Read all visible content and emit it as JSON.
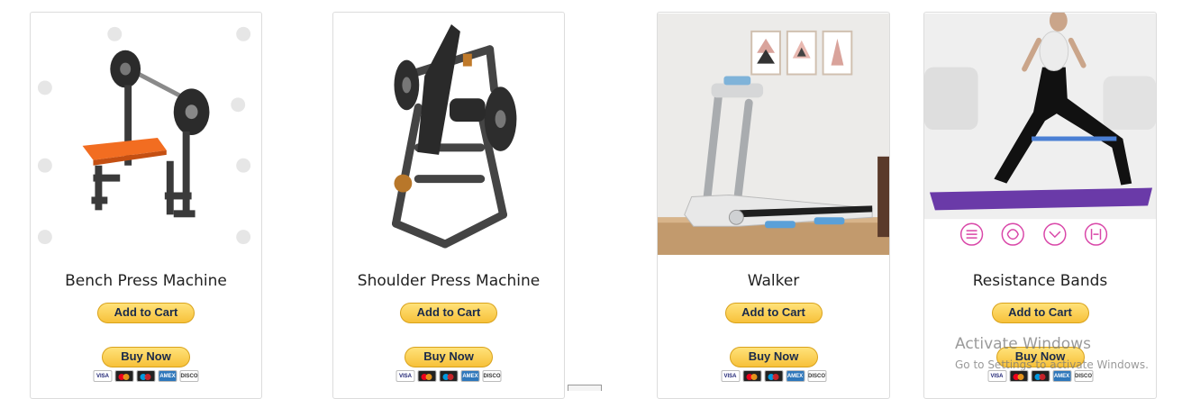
{
  "products": [
    {
      "name": "Bench Press Machine",
      "image_icon": "bench-press-image",
      "add_to_cart": "Add to Cart",
      "buy_now": "Buy Now"
    },
    {
      "name": "Shoulder Press Machine",
      "image_icon": "shoulder-press-image",
      "add_to_cart": "Add to Cart",
      "buy_now": "Buy Now"
    },
    {
      "name": "Walker",
      "image_icon": "treadmill-image",
      "add_to_cart": "Add to Cart",
      "buy_now": "Buy Now"
    },
    {
      "name": "Resistance Bands",
      "image_icon": "resistance-bands-image",
      "add_to_cart": "Add to Cart",
      "buy_now": "Buy Now"
    }
  ],
  "payment_cards": [
    "VISA",
    "Mastercard",
    "Maestro",
    "AMEX",
    "DISCOVER"
  ],
  "payment_card_labels": {
    "visa": "VISA",
    "amex": "AMEX",
    "discover": "DISCOVER"
  },
  "colors": {
    "button_gold": "#f7c13a",
    "button_text": "#1a2a4a",
    "accent_orange": "#f26d21",
    "treadmill_blue": "#5aa0d8",
    "mat_purple": "#6a3aa8"
  },
  "os_watermark": {
    "title": "Activate Windows",
    "subtitle": "Go to Settings to activate Windows."
  }
}
